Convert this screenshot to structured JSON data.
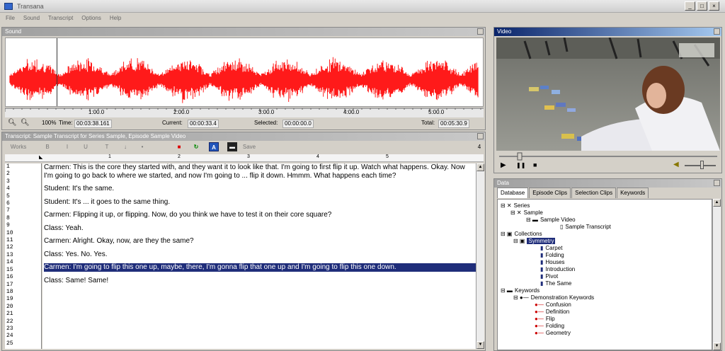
{
  "window": {
    "title": "Transana"
  },
  "menu": [
    "File",
    "Sound",
    "Transcript",
    "Options",
    "Help"
  ],
  "sound_panel": {
    "title": "Sound",
    "ruler_ticks": [
      "1:00.0",
      "2:00.0",
      "3:00.0",
      "4:00.0",
      "5:00.0"
    ],
    "zoom_label": "100%",
    "time_label": "Time:",
    "time_value": "00:03:38.161",
    "current_label": "Current:",
    "current_value": "00:00:33.4",
    "selected_label": "Selected:",
    "selected_value": "00:00:00.0",
    "total_label": "Total:",
    "total_value": "00:05:30.9",
    "waveform_color": "#ff1a1a"
  },
  "transcript_panel": {
    "title": "Transcript: Sample Transcript for Series Sample, Episode Sample Video",
    "toolbar": {
      "mode": "Works",
      "bold": "B",
      "italic": "I",
      "underline": "U",
      "t1": "T",
      "t2": "↓",
      "t3": "•",
      "save": "Save",
      "count": "4"
    },
    "ruler_ticks": [
      "1",
      "2",
      "3",
      "4",
      "5"
    ],
    "line_numbers": [
      "1",
      "2",
      "3",
      "4",
      "5",
      "6",
      "7",
      "8",
      "9",
      "10",
      "11",
      "12",
      "13",
      "14",
      "15",
      "16",
      "17",
      "18",
      "19",
      "20",
      "21",
      "22",
      "23",
      "24",
      "25"
    ],
    "paragraphs": [
      "Carmen:  This is the core they started with, and they want it to look like that.  I'm going to first flip it up.  Watch what happens.  Okay.  Now I'm going to go back to where we started, and now I'm going to ... flip it down.  Hmmm.  What happens each time?",
      "Student:  It's the same.",
      "Student:  It's ... it goes to the same thing.",
      "Carmen:  Flipping it up, or flipping.  Now, do you think we have to test it on their core square?",
      "Class:  Yeah.",
      "Carmen:  Alright.  Okay, now, are they the same?",
      "Class:  Yes.  No.  Yes.",
      "Carmen:  I'm going to flip this one up, maybe, there, I'm gonna flip that one up and I'm going to flip this one down.",
      "Class:  Same!  Same!"
    ],
    "selection_color": "#1f2d7a"
  },
  "video_panel": {
    "title": "Video"
  },
  "data_panel": {
    "title": "Data",
    "tabs": [
      "Database",
      "Episode Clips",
      "Selection Clips",
      "Keywords"
    ],
    "tree": [
      "Series",
      "Sample",
      "Sample Video",
      "Sample Transcript",
      "Collections",
      "Symmetry",
      "Carpet",
      "Folding",
      "Houses",
      "Introduction",
      "Pivot",
      "The Same",
      "Keywords",
      "Demonstration Keywords",
      "Confusion",
      "Definition",
      "Flip",
      "Folding",
      "Geometry"
    ]
  }
}
